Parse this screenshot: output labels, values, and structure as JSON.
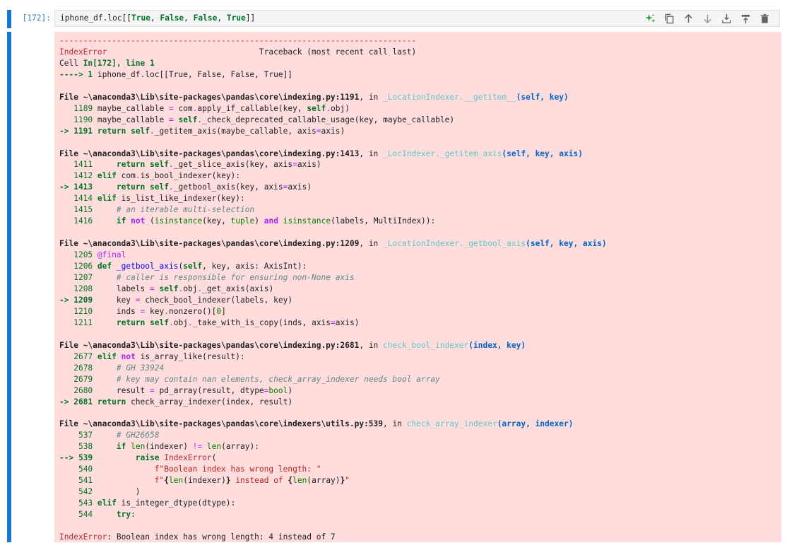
{
  "input_cell": {
    "prompt": "[172]:",
    "code_prefix": "iphone_df.loc[[",
    "code_true1": "True",
    "code_sep1": ", ",
    "code_false1": "False",
    "code_sep2": ", ",
    "code_false2": "False",
    "code_sep3": ", ",
    "code_true2": "True",
    "code_suffix": "]]"
  },
  "toolbar": {
    "icons": [
      "sparkle-icon",
      "duplicate-icon",
      "move-up-icon",
      "move-down-icon",
      "insert-above-icon",
      "insert-below-icon",
      "delete-icon"
    ]
  },
  "traceback": {
    "dash_line": "---------------------------------------------------------------------------",
    "error_name": "IndexError",
    "traceback_header": "Traceback (most recent call last)",
    "cell_line_a": "Cell ",
    "cell_line_b": "In[172], line 1",
    "arrow_line_a": "----> 1 ",
    "arrow_line_code": "iphone_df.loc[[True, False, False, True]]",
    "frames": {
      "f1_file": "File ~\\anaconda3\\Lib\\site-packages\\pandas\\core\\indexing.py:1191",
      "f1_in": ", in ",
      "f1_func": "_LocationIndexer.__getitem__",
      "f1_args": "(self, key)",
      "f2_file": "File ~\\anaconda3\\Lib\\site-packages\\pandas\\core\\indexing.py:1413",
      "f2_in": ", in ",
      "f2_func": "_LocIndexer._getitem_axis",
      "f2_args": "(self, key, axis)",
      "f3_file": "File ~\\anaconda3\\Lib\\site-packages\\pandas\\core\\indexing.py:1209",
      "f3_in": ", in ",
      "f3_func": "_LocationIndexer._getbool_axis",
      "f3_args": "(self, key, axis)",
      "f4_file": "File ~\\anaconda3\\Lib\\site-packages\\pandas\\core\\indexing.py:2681",
      "f4_in": ", in ",
      "f4_func": "check_bool_indexer",
      "f4_args": "(index, key)",
      "f5_file": "File ~\\anaconda3\\Lib\\site-packages\\pandas\\core\\indexers\\utils.py:539",
      "f5_in": ", in ",
      "f5_func": "check_array_indexer",
      "f5_args": "(array, indexer)"
    },
    "final_error_name": "IndexError",
    "final_error_msg": ": Boolean index has wrong length: 4 instead of 7"
  }
}
